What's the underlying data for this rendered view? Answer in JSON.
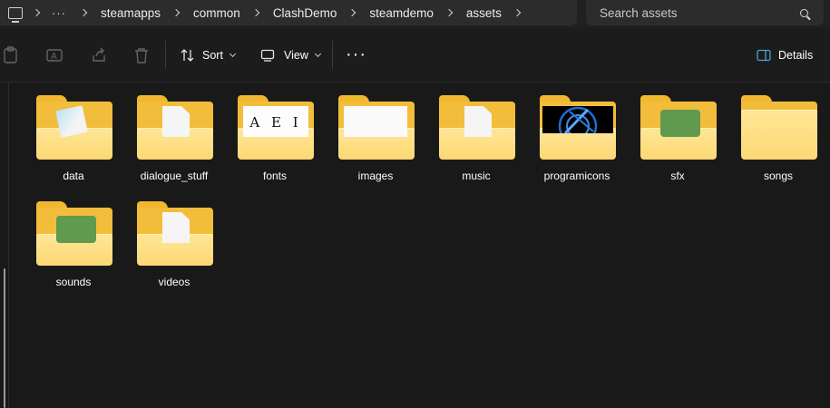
{
  "address_bar": {
    "overflow": "···",
    "breadcrumbs": [
      "steamapps",
      "common",
      "ClashDemo",
      "steamdemo",
      "assets"
    ]
  },
  "search": {
    "placeholder": "Search assets"
  },
  "command_bar": {
    "sort_label": "Sort",
    "view_label": "View",
    "more_label": "···",
    "details_label": "Details"
  },
  "folders": [
    {
      "name": "data",
      "thumb": "notepad-icon"
    },
    {
      "name": "dialogue_stuff",
      "thumb": "document-icon"
    },
    {
      "name": "fonts",
      "thumb": "font-preview"
    },
    {
      "name": "images",
      "thumb": "blank-image"
    },
    {
      "name": "music",
      "thumb": "document-icon"
    },
    {
      "name": "programicons",
      "thumb": "blue-logo-image"
    },
    {
      "name": "sfx",
      "thumb": "green-audio-icon"
    },
    {
      "name": "songs",
      "thumb": "none"
    },
    {
      "name": "sounds",
      "thumb": "green-audio-icon"
    },
    {
      "name": "videos",
      "thumb": "document-icon"
    }
  ],
  "font_preview_text": "A E I",
  "colors": {
    "folder": "#f2bd3a",
    "folder_front": "#fcd874",
    "accent": "#4aa3df",
    "background": "#191919"
  }
}
